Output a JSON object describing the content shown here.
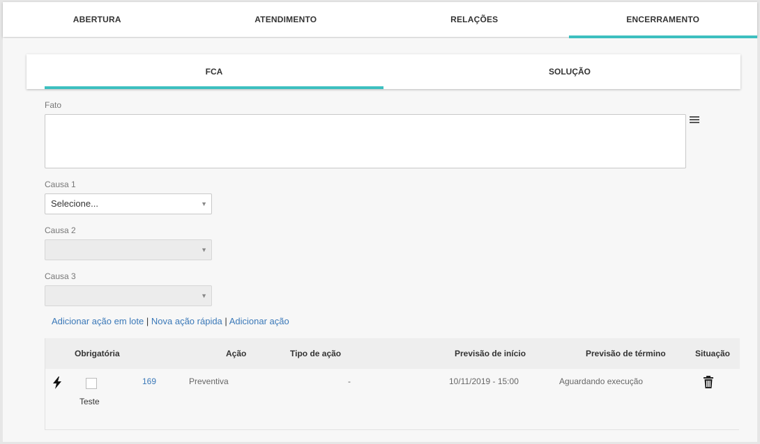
{
  "top_tabs": [
    "ABERTURA",
    "ATENDIMENTO",
    "RELAÇÕES",
    "ENCERRAMENTO"
  ],
  "active_top_tab": "ENCERRAMENTO",
  "sub_tabs": [
    "FCA",
    "SOLUÇÃO"
  ],
  "active_sub_tab": "FCA",
  "form": {
    "fato_label": "Fato",
    "fato_value": "",
    "causa1_label": "Causa 1",
    "causa1_value": "Selecione...",
    "causa2_label": "Causa 2",
    "causa2_value": "",
    "causa3_label": "Causa 3",
    "causa3_value": ""
  },
  "actions": {
    "lote": "Adicionar ação em lote",
    "rapida": "Nova ação rápida",
    "adicionar": "Adicionar ação",
    "separator": "|"
  },
  "table": {
    "headers": {
      "obrigatoria": "Obrigatória",
      "acao": "Ação",
      "tipo": "Tipo de ação",
      "inicio": "Previsão de início",
      "termino": "Previsão de término",
      "situacao": "Situação"
    },
    "rows": [
      {
        "id": "169",
        "acao": "Preventiva",
        "tipo": "-",
        "inicio": "10/11/2019 - 15:00",
        "termino": "Aguardando execução",
        "obrigatoria_label": "Teste",
        "obrigatoria_checked": false
      }
    ]
  },
  "colors": {
    "accent": "#3dbfbf",
    "link": "#3a78b8"
  },
  "icons": [
    "menu-icon",
    "chevron-down-icon",
    "bolt-icon",
    "trash-icon"
  ]
}
